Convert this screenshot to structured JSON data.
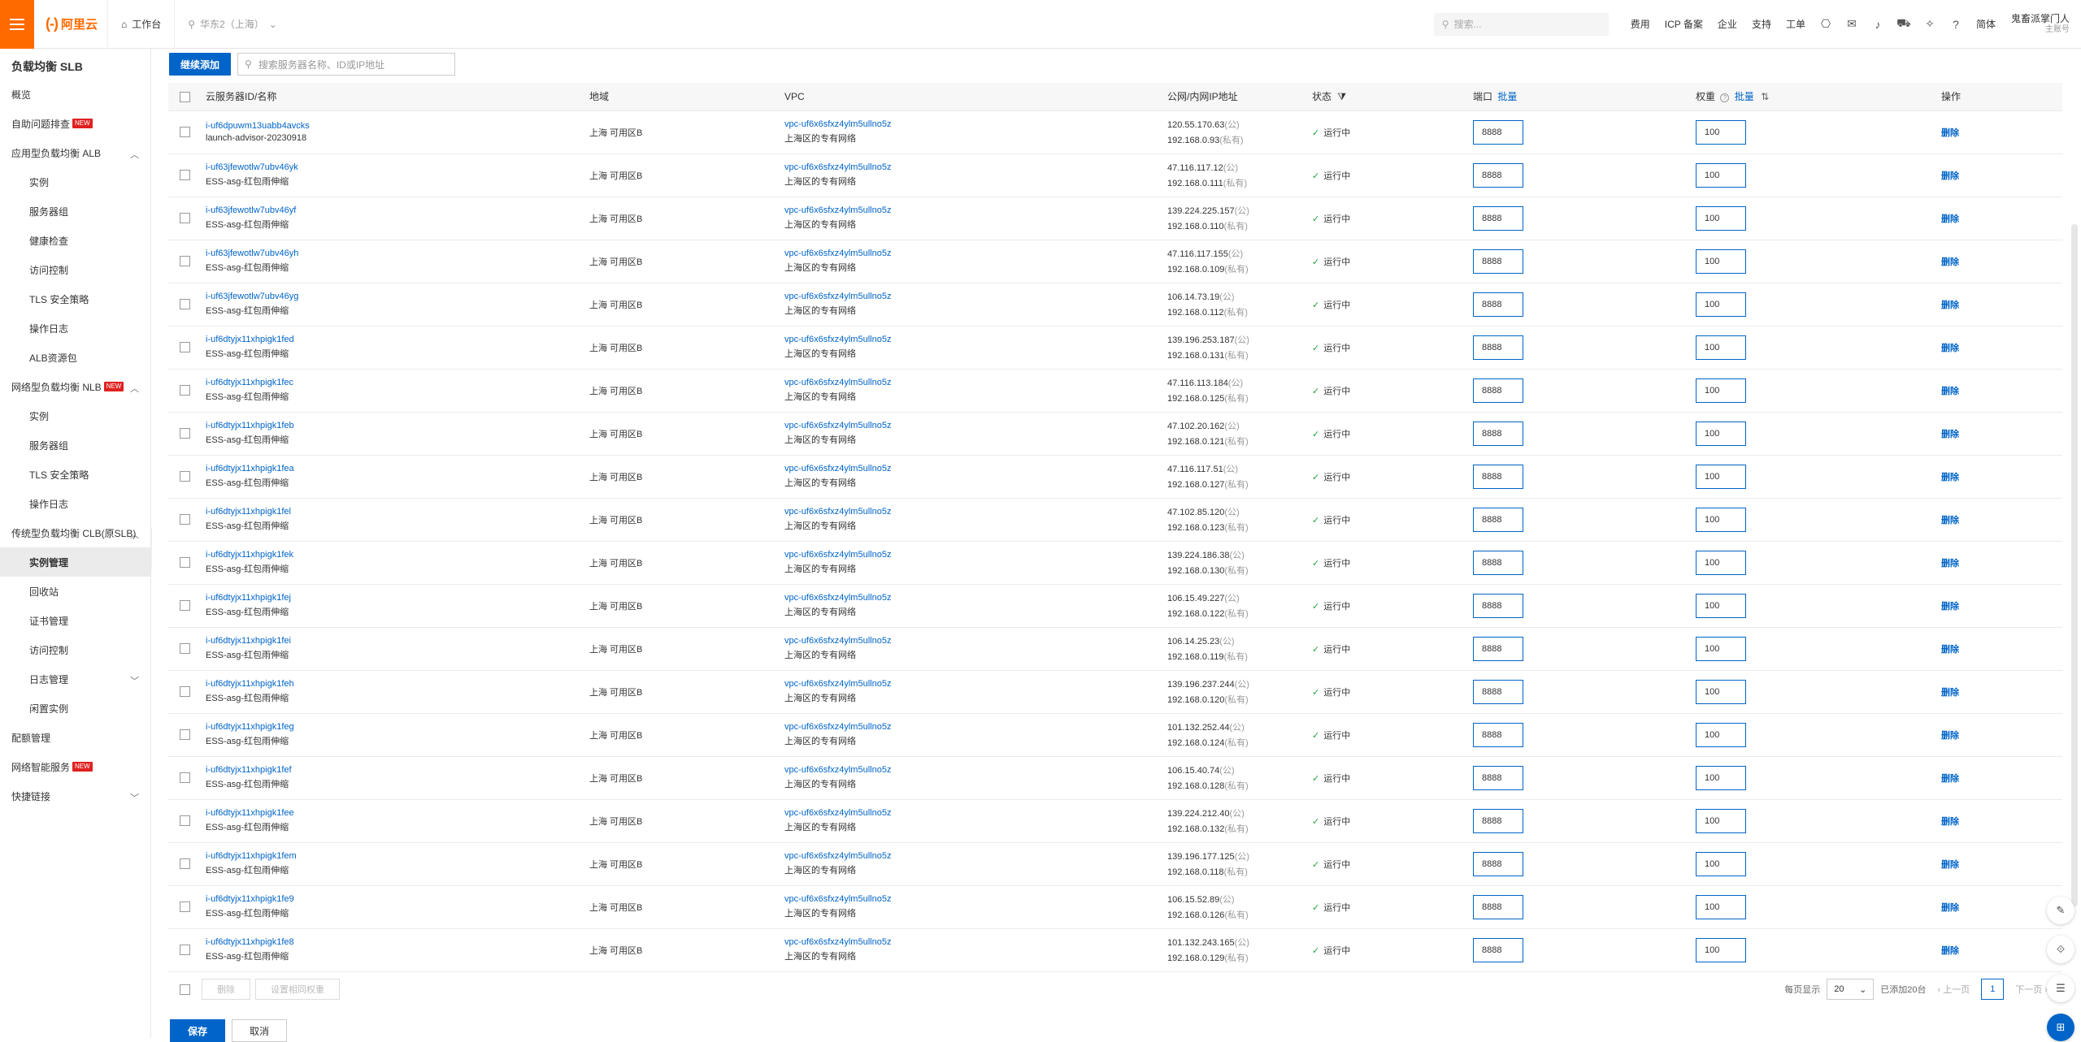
{
  "topbar": {
    "logo_mark": "(-)",
    "logo_text": "阿里云",
    "workbench": "工作台",
    "region": "华东2（上海）",
    "search_placeholder": "搜索...",
    "links": [
      "费用",
      "ICP 备案",
      "企业",
      "支持",
      "工单"
    ],
    "lang": "简体",
    "user_name": "鬼畜派掌门人",
    "user_role": "主账号"
  },
  "sidebar": {
    "title": "负载均衡 SLB",
    "items": [
      {
        "label": "概览",
        "level": 0
      },
      {
        "label": "自助问题排查",
        "level": 0,
        "badge": "NEW"
      },
      {
        "label": "应用型负载均衡 ALB",
        "level": 0,
        "chevron": "up"
      },
      {
        "label": "实例",
        "level": 1
      },
      {
        "label": "服务器组",
        "level": 1
      },
      {
        "label": "健康检查",
        "level": 1
      },
      {
        "label": "访问控制",
        "level": 1
      },
      {
        "label": "TLS 安全策略",
        "level": 1
      },
      {
        "label": "操作日志",
        "level": 1
      },
      {
        "label": "ALB资源包",
        "level": 1
      },
      {
        "label": "网络型负载均衡 NLB",
        "level": 0,
        "badge": "NEW",
        "chevron": "up"
      },
      {
        "label": "实例",
        "level": 1
      },
      {
        "label": "服务器组",
        "level": 1
      },
      {
        "label": "TLS 安全策略",
        "level": 1
      },
      {
        "label": "操作日志",
        "level": 1
      },
      {
        "label": "传统型负载均衡 CLB(原SLB)",
        "level": 0,
        "chevron": "up"
      },
      {
        "label": "实例管理",
        "level": 1,
        "active": true
      },
      {
        "label": "回收站",
        "level": 1
      },
      {
        "label": "证书管理",
        "level": 1
      },
      {
        "label": "访问控制",
        "level": 1
      },
      {
        "label": "日志管理",
        "level": 1,
        "chevron": "down"
      },
      {
        "label": "闲置实例",
        "level": 1
      },
      {
        "label": "配额管理",
        "level": 0
      },
      {
        "label": "网络智能服务",
        "level": 0,
        "badge": "NEW"
      },
      {
        "label": "快捷链接",
        "level": 0,
        "chevron": "down"
      }
    ]
  },
  "toolbar": {
    "add_button": "继续添加",
    "search_placeholder": "搜索服务器名称、ID或IP地址"
  },
  "table": {
    "headers": {
      "id": "云服务器ID/名称",
      "zone": "地域",
      "vpc": "VPC",
      "ip": "公网/内网IP地址",
      "status": "状态",
      "port": "端口",
      "port_batch": "批量",
      "weight": "权重",
      "weight_batch": "批量",
      "op": "操作"
    },
    "public_suffix": "(公)",
    "private_suffix": "(私有)",
    "delete_label": "删除",
    "rows": [
      {
        "id": "i-uf6dpuwm13uabb4avcks",
        "name": "launch-advisor-20230918",
        "zone": "上海 可用区B",
        "vpc": "vpc-uf6x6sfxz4ylm5ullno5z",
        "vpc_name": "上海区的专有网络",
        "pub": "120.55.170.63",
        "priv": "192.168.0.93",
        "status": "运行中",
        "port": "8888",
        "weight": "100"
      },
      {
        "id": "i-uf63jfewotlw7ubv46yk",
        "name": "ESS-asg-红包雨伸缩",
        "zone": "上海 可用区B",
        "vpc": "vpc-uf6x6sfxz4ylm5ullno5z",
        "vpc_name": "上海区的专有网络",
        "pub": "47.116.117.12",
        "priv": "192.168.0.111",
        "status": "运行中",
        "port": "8888",
        "weight": "100"
      },
      {
        "id": "i-uf63jfewotlw7ubv46yf",
        "name": "ESS-asg-红包雨伸缩",
        "zone": "上海 可用区B",
        "vpc": "vpc-uf6x6sfxz4ylm5ullno5z",
        "vpc_name": "上海区的专有网络",
        "pub": "139.224.225.157",
        "priv": "192.168.0.110",
        "status": "运行中",
        "port": "8888",
        "weight": "100"
      },
      {
        "id": "i-uf63jfewotlw7ubv46yh",
        "name": "ESS-asg-红包雨伸缩",
        "zone": "上海 可用区B",
        "vpc": "vpc-uf6x6sfxz4ylm5ullno5z",
        "vpc_name": "上海区的专有网络",
        "pub": "47.116.117.155",
        "priv": "192.168.0.109",
        "status": "运行中",
        "port": "8888",
        "weight": "100"
      },
      {
        "id": "i-uf63jfewotlw7ubv46yg",
        "name": "ESS-asg-红包雨伸缩",
        "zone": "上海 可用区B",
        "vpc": "vpc-uf6x6sfxz4ylm5ullno5z",
        "vpc_name": "上海区的专有网络",
        "pub": "106.14.73.19",
        "priv": "192.168.0.112",
        "status": "运行中",
        "port": "8888",
        "weight": "100"
      },
      {
        "id": "i-uf6dtyjx11xhpigk1fed",
        "name": "ESS-asg-红包雨伸缩",
        "zone": "上海 可用区B",
        "vpc": "vpc-uf6x6sfxz4ylm5ullno5z",
        "vpc_name": "上海区的专有网络",
        "pub": "139.196.253.187",
        "priv": "192.168.0.131",
        "status": "运行中",
        "port": "8888",
        "weight": "100"
      },
      {
        "id": "i-uf6dtyjx11xhpigk1fec",
        "name": "ESS-asg-红包雨伸缩",
        "zone": "上海 可用区B",
        "vpc": "vpc-uf6x6sfxz4ylm5ullno5z",
        "vpc_name": "上海区的专有网络",
        "pub": "47.116.113.184",
        "priv": "192.168.0.125",
        "status": "运行中",
        "port": "8888",
        "weight": "100"
      },
      {
        "id": "i-uf6dtyjx11xhpigk1feb",
        "name": "ESS-asg-红包雨伸缩",
        "zone": "上海 可用区B",
        "vpc": "vpc-uf6x6sfxz4ylm5ullno5z",
        "vpc_name": "上海区的专有网络",
        "pub": "47.102.20.162",
        "priv": "192.168.0.121",
        "status": "运行中",
        "port": "8888",
        "weight": "100"
      },
      {
        "id": "i-uf6dtyjx11xhpigk1fea",
        "name": "ESS-asg-红包雨伸缩",
        "zone": "上海 可用区B",
        "vpc": "vpc-uf6x6sfxz4ylm5ullno5z",
        "vpc_name": "上海区的专有网络",
        "pub": "47.116.117.51",
        "priv": "192.168.0.127",
        "status": "运行中",
        "port": "8888",
        "weight": "100"
      },
      {
        "id": "i-uf6dtyjx11xhpigk1fel",
        "name": "ESS-asg-红包雨伸缩",
        "zone": "上海 可用区B",
        "vpc": "vpc-uf6x6sfxz4ylm5ullno5z",
        "vpc_name": "上海区的专有网络",
        "pub": "47.102.85.120",
        "priv": "192.168.0.123",
        "status": "运行中",
        "port": "8888",
        "weight": "100"
      },
      {
        "id": "i-uf6dtyjx11xhpigk1fek",
        "name": "ESS-asg-红包雨伸缩",
        "zone": "上海 可用区B",
        "vpc": "vpc-uf6x6sfxz4ylm5ullno5z",
        "vpc_name": "上海区的专有网络",
        "pub": "139.224.186.38",
        "priv": "192.168.0.130",
        "status": "运行中",
        "port": "8888",
        "weight": "100"
      },
      {
        "id": "i-uf6dtyjx11xhpigk1fej",
        "name": "ESS-asg-红包雨伸缩",
        "zone": "上海 可用区B",
        "vpc": "vpc-uf6x6sfxz4ylm5ullno5z",
        "vpc_name": "上海区的专有网络",
        "pub": "106.15.49.227",
        "priv": "192.168.0.122",
        "status": "运行中",
        "port": "8888",
        "weight": "100"
      },
      {
        "id": "i-uf6dtyjx11xhpigk1fei",
        "name": "ESS-asg-红包雨伸缩",
        "zone": "上海 可用区B",
        "vpc": "vpc-uf6x6sfxz4ylm5ullno5z",
        "vpc_name": "上海区的专有网络",
        "pub": "106.14.25.23",
        "priv": "192.168.0.119",
        "status": "运行中",
        "port": "8888",
        "weight": "100"
      },
      {
        "id": "i-uf6dtyjx11xhpigk1feh",
        "name": "ESS-asg-红包雨伸缩",
        "zone": "上海 可用区B",
        "vpc": "vpc-uf6x6sfxz4ylm5ullno5z",
        "vpc_name": "上海区的专有网络",
        "pub": "139.196.237.244",
        "priv": "192.168.0.120",
        "status": "运行中",
        "port": "8888",
        "weight": "100"
      },
      {
        "id": "i-uf6dtyjx11xhpigk1feg",
        "name": "ESS-asg-红包雨伸缩",
        "zone": "上海 可用区B",
        "vpc": "vpc-uf6x6sfxz4ylm5ullno5z",
        "vpc_name": "上海区的专有网络",
        "pub": "101.132.252.44",
        "priv": "192.168.0.124",
        "status": "运行中",
        "port": "8888",
        "weight": "100"
      },
      {
        "id": "i-uf6dtyjx11xhpigk1fef",
        "name": "ESS-asg-红包雨伸缩",
        "zone": "上海 可用区B",
        "vpc": "vpc-uf6x6sfxz4ylm5ullno5z",
        "vpc_name": "上海区的专有网络",
        "pub": "106.15.40.74",
        "priv": "192.168.0.128",
        "status": "运行中",
        "port": "8888",
        "weight": "100"
      },
      {
        "id": "i-uf6dtyjx11xhpigk1fee",
        "name": "ESS-asg-红包雨伸缩",
        "zone": "上海 可用区B",
        "vpc": "vpc-uf6x6sfxz4ylm5ullno5z",
        "vpc_name": "上海区的专有网络",
        "pub": "139.224.212.40",
        "priv": "192.168.0.132",
        "status": "运行中",
        "port": "8888",
        "weight": "100"
      },
      {
        "id": "i-uf6dtyjx11xhpigk1fem",
        "name": "ESS-asg-红包雨伸缩",
        "zone": "上海 可用区B",
        "vpc": "vpc-uf6x6sfxz4ylm5ullno5z",
        "vpc_name": "上海区的专有网络",
        "pub": "139.196.177.125",
        "priv": "192.168.0.118",
        "status": "运行中",
        "port": "8888",
        "weight": "100"
      },
      {
        "id": "i-uf6dtyjx11xhpigk1fe9",
        "name": "ESS-asg-红包雨伸缩",
        "zone": "上海 可用区B",
        "vpc": "vpc-uf6x6sfxz4ylm5ullno5z",
        "vpc_name": "上海区的专有网络",
        "pub": "106.15.52.89",
        "priv": "192.168.0.126",
        "status": "运行中",
        "port": "8888",
        "weight": "100"
      },
      {
        "id": "i-uf6dtyjx11xhpigk1fe8",
        "name": "ESS-asg-红包雨伸缩",
        "zone": "上海 可用区B",
        "vpc": "vpc-uf6x6sfxz4ylm5ullno5z",
        "vpc_name": "上海区的专有网络",
        "pub": "101.132.243.165",
        "priv": "192.168.0.129",
        "status": "运行中",
        "port": "8888",
        "weight": "100"
      }
    ]
  },
  "footer": {
    "delete_button": "删除",
    "batch_weight_button": "设置相同权重",
    "page_size_label": "每页显示",
    "page_size": "20",
    "selected_text": "已添加20台",
    "prev": "上一页",
    "page": "1",
    "next": "下一页"
  },
  "actions": {
    "save": "保存",
    "cancel": "取消"
  },
  "colors": {
    "brand": "#ff6a00",
    "primary": "#0064c8",
    "status_ok": "#22a33a"
  }
}
